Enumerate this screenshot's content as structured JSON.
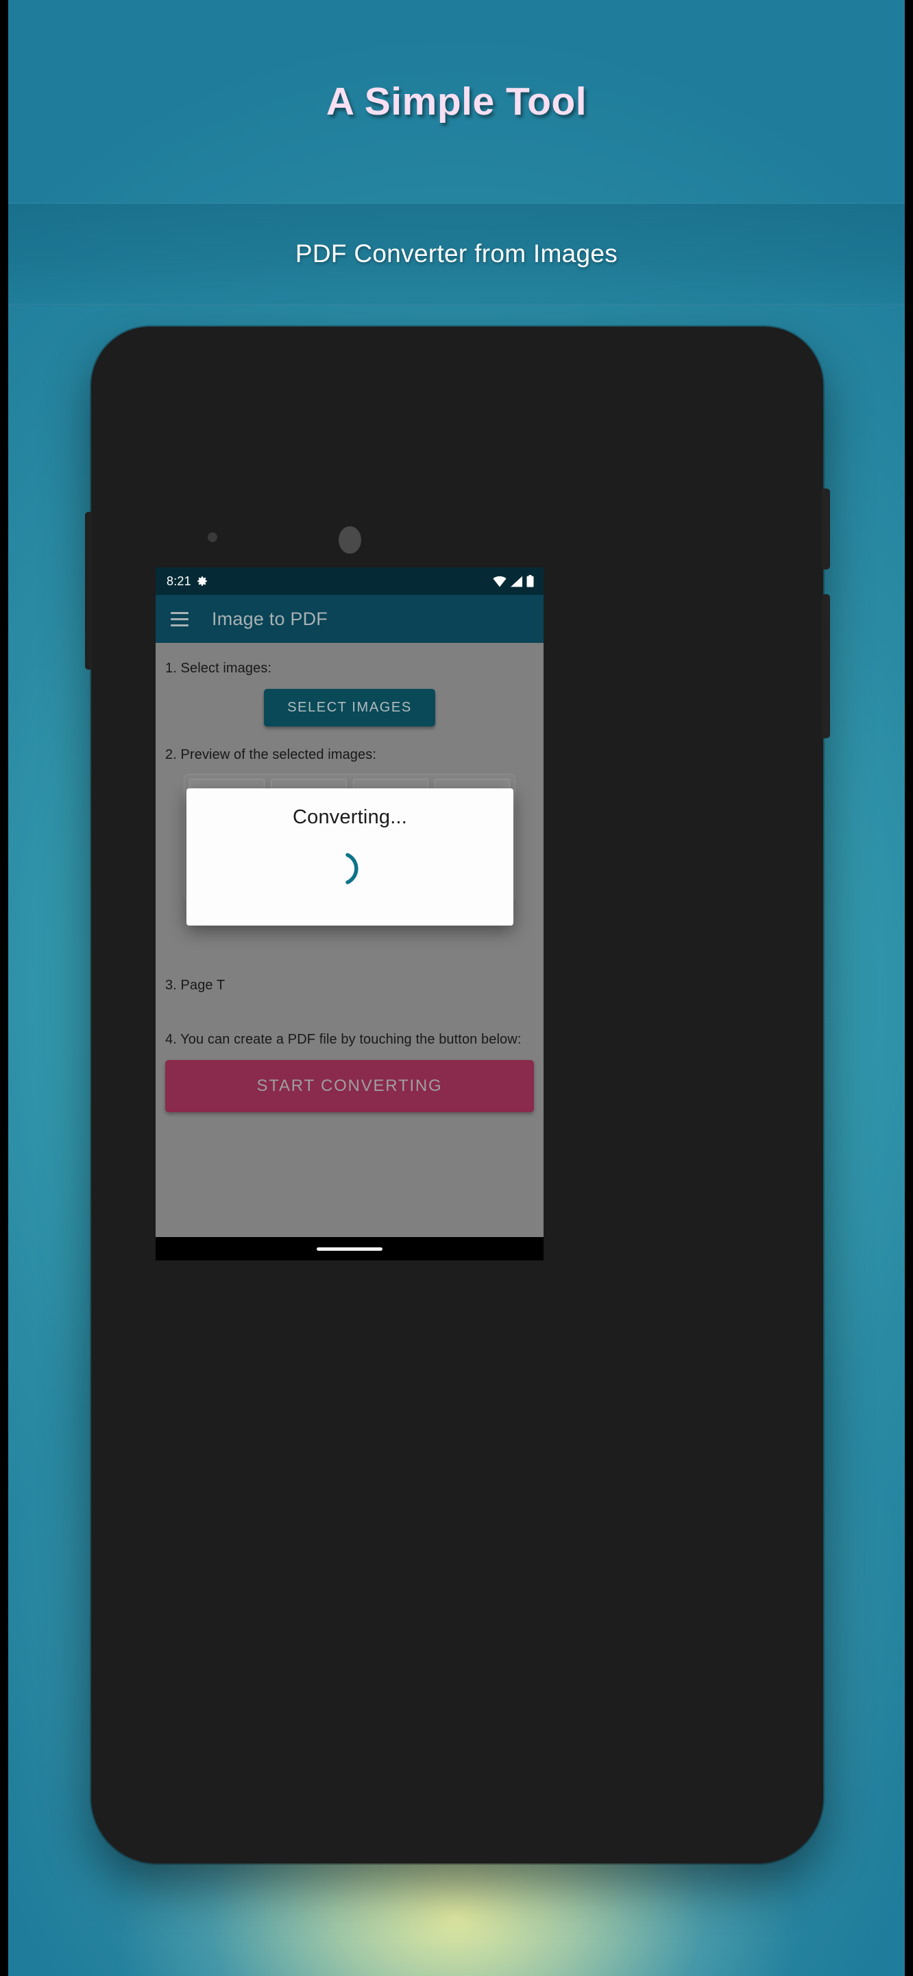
{
  "hero": {
    "title": "A Simple Tool",
    "subtitle": "PDF Converter from Images"
  },
  "colors": {
    "backdrop_teal": "#2b8ba4",
    "backdrop_glow": "#e9eda0",
    "hero_title": "#f8dff2",
    "status_bar": "#052a35",
    "app_bar": "#0a4456",
    "app_bar_title": "#a8b1b4",
    "content_bg": "#808080",
    "select_button_bg": "#0a4a58",
    "start_button_bg": "#8a2a4c",
    "spinner": "#0d7389",
    "dialog_bg": "#fdfdfd",
    "phone_body": "#1d1d1d"
  },
  "phone": {
    "status_bar": {
      "time": "8:21",
      "gear_icon": "gear-icon",
      "wifi_icon": "wifi-icon",
      "signal_icon": "cellular-signal-icon",
      "battery_icon": "battery-full-icon"
    },
    "app_bar": {
      "menu_icon": "hamburger-menu-icon",
      "title": "Image to PDF"
    },
    "content": {
      "step1_label": "1. Select images:",
      "select_images_label": "SELECT IMAGES",
      "step2_label": "2. Preview of the selected images:",
      "thumbnails": [
        {
          "name": "coastal-rock-sunset-thumbnail",
          "art": "art-coast"
        },
        {
          "name": "desert-mesa-thumbnail",
          "art": "art-desert"
        },
        {
          "name": "mountain-autumn-thumbnail",
          "art": "art-mountain"
        },
        {
          "name": "picture-frame-flowers-thumbnail",
          "art": "art-frame"
        }
      ],
      "step3_label": "3. Page T",
      "step4_label": "4. You can create a PDF file by touching the button below:",
      "start_converting_label": "START CONVERTING"
    },
    "dialog": {
      "title": "Converting...",
      "spinner_icon": "loading-spinner-icon"
    },
    "nav_bar": {
      "gesture_pill": "gesture-home-pill"
    }
  }
}
